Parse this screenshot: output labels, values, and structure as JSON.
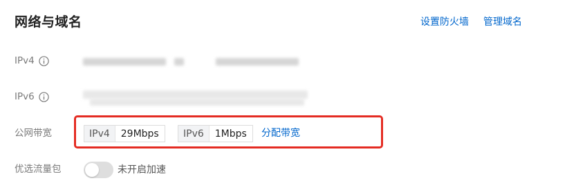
{
  "section": {
    "title": "网络与域名",
    "links": {
      "firewall": "设置防火墙",
      "manage_domain": "管理域名"
    }
  },
  "rows": {
    "ipv4_label": "IPv4",
    "ipv6_label": "IPv6",
    "bandwidth_label": "公网带宽",
    "traffic_label": "优选流量包"
  },
  "bandwidth": {
    "ipv4_tag": "IPv4",
    "ipv4_value": "29Mbps",
    "ipv6_tag": "IPv6",
    "ipv6_value": "1Mbps",
    "allocate_link": "分配带宽"
  },
  "acceleration": {
    "enabled": false,
    "label": "未开启加速"
  },
  "colors": {
    "link": "#0066cc",
    "highlight_border": "#e42b22",
    "label_gray": "#7a7a7a"
  },
  "icons": {
    "info": "info-circle-icon"
  }
}
